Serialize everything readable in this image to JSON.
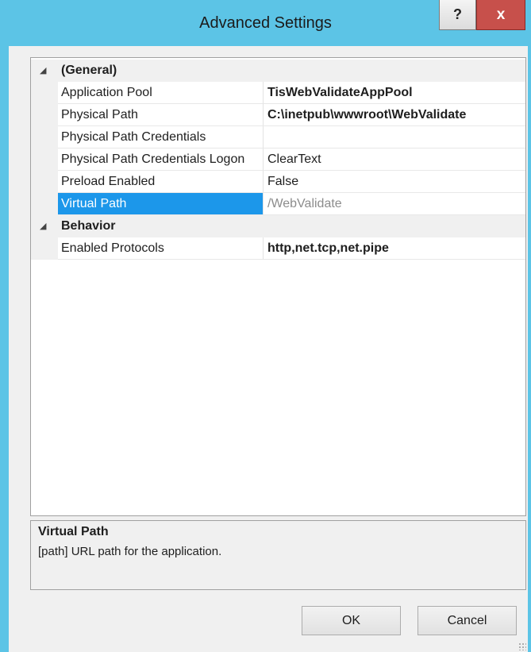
{
  "window": {
    "title": "Advanced Settings",
    "help_label": "?",
    "close_label": "x"
  },
  "grid": {
    "categories": [
      {
        "label": "(General)",
        "properties": [
          {
            "name": "Application Pool",
            "value": "TisWebValidateAppPool",
            "bold": true
          },
          {
            "name": "Physical Path",
            "value": "C:\\inetpub\\wwwroot\\WebValidate",
            "bold": true
          },
          {
            "name": "Physical Path Credentials",
            "value": "",
            "bold": false
          },
          {
            "name": "Physical Path Credentials Logon",
            "value": "ClearText",
            "bold": false
          },
          {
            "name": "Preload Enabled",
            "value": "False",
            "bold": false
          },
          {
            "name": "Virtual Path",
            "value": "/WebValidate",
            "bold": false,
            "selected": true
          }
        ]
      },
      {
        "label": "Behavior",
        "properties": [
          {
            "name": "Enabled Protocols",
            "value": "http,net.tcp,net.pipe",
            "bold": true
          }
        ]
      }
    ],
    "expander_glyph": "◢"
  },
  "description": {
    "title": "Virtual Path",
    "text": "[path] URL path for the application."
  },
  "buttons": {
    "ok": "OK",
    "cancel": "Cancel"
  },
  "colors": {
    "titlebar": "#5cc4e6",
    "selection": "#1c97ea",
    "close": "#c7504b"
  }
}
